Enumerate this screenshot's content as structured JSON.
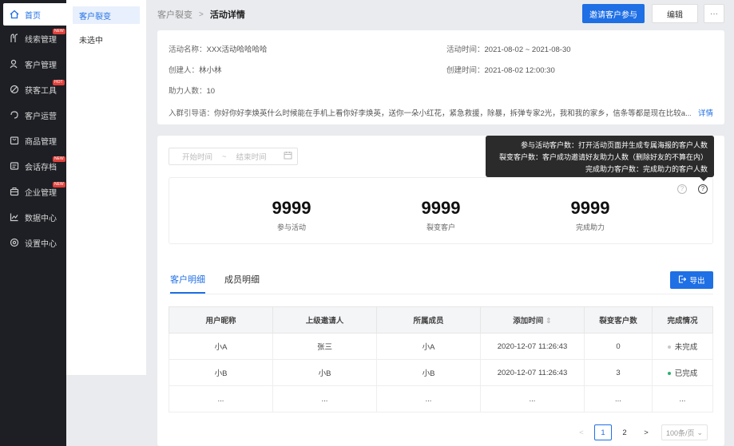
{
  "nav": {
    "items": [
      {
        "label": "首页",
        "icon": "home-icon",
        "badge": ""
      },
      {
        "label": "线索管理",
        "icon": "clue-icon",
        "badge": "NEW"
      },
      {
        "label": "客户管理",
        "icon": "customer-icon",
        "badge": ""
      },
      {
        "label": "获客工具",
        "icon": "tool-icon",
        "badge": "HOT"
      },
      {
        "label": "客户运营",
        "icon": "operation-icon",
        "badge": ""
      },
      {
        "label": "商品管理",
        "icon": "goods-icon",
        "badge": ""
      },
      {
        "label": "会话存档",
        "icon": "chat-archive-icon",
        "badge": "NEW"
      },
      {
        "label": "企业管理",
        "icon": "enterprise-icon",
        "badge": "NEW"
      },
      {
        "label": "数据中心",
        "icon": "chart-icon",
        "badge": ""
      },
      {
        "label": "设置中心",
        "icon": "settings-icon",
        "badge": ""
      }
    ]
  },
  "subnav": {
    "items": [
      {
        "label": "客户裂变"
      },
      {
        "label": "未选中"
      }
    ]
  },
  "header": {
    "crumb_parent": "客户裂变",
    "crumb_sep": ">",
    "crumb_current": "活动详情",
    "invite_label": "邀请客户参与",
    "edit_label": "编辑",
    "more_label": "···"
  },
  "info": {
    "name_key": "活动名称：",
    "name_val": "XXX活动哈哈哈哈",
    "time_key": "活动时间：",
    "time_val": "2021-08-02 ~ 2021-08-30",
    "creator_key": "创建人：",
    "creator_val": "林小林",
    "created_key": "创建时间：",
    "created_val": "2021-08-02  12:00:30",
    "helpers_key": "助力人数：",
    "helpers_val": "10",
    "guide_key": "入群引导语：",
    "guide_val": "你好你好李焕英什么时候能在手机上看你好李焕英，送你一朵小红花，紧急救援，除暴，拆弹专家2光，我和我的家乡，信条等都是现在比较a...",
    "more_link": "详情"
  },
  "filter": {
    "start_placeholder": "开始时间",
    "sep": "~",
    "end_placeholder": "结束时间"
  },
  "tooltip": {
    "line1": "参与活动客户数：打开活动页面并生成专属海报的客户人数",
    "line2": "裂变客户数：客户成功邀请好友助力人数（删除好友的不算在内）",
    "line3": "完成助力客户数：完成助力的客户人数"
  },
  "stats": [
    {
      "value": "9999",
      "label": "参与活动"
    },
    {
      "value": "9999",
      "label": "裂变客户"
    },
    {
      "value": "9999",
      "label": "完成助力"
    }
  ],
  "tabs": [
    {
      "label": "客户明细"
    },
    {
      "label": "成员明细"
    }
  ],
  "export_label": "导出",
  "table": {
    "headers": [
      "用户昵称",
      "上级邀请人",
      "所属成员",
      "添加时间",
      "裂变客户数",
      "完成情况"
    ],
    "sort_icon": "⇕",
    "rows": [
      [
        "小A",
        "张三",
        "小A",
        "2020-12-07  11:26:43",
        "0",
        "未完成"
      ],
      [
        "小B",
        "小B",
        "小B",
        "2020-12-07  11:26:43",
        "3",
        "已完成"
      ],
      [
        "...",
        "...",
        "...",
        "...",
        "...",
        "..."
      ]
    ],
    "status_colors": {
      "未完成": "#c8c8c8",
      "已完成": "#27b26a"
    }
  },
  "pager": {
    "prev": "<",
    "pages": [
      "1",
      "2"
    ],
    "next": ">",
    "size": "100条/页"
  },
  "colors": {
    "primary": "#1f6fe5",
    "nav_bg": "#1d1f24",
    "badge": "#e2413b"
  }
}
